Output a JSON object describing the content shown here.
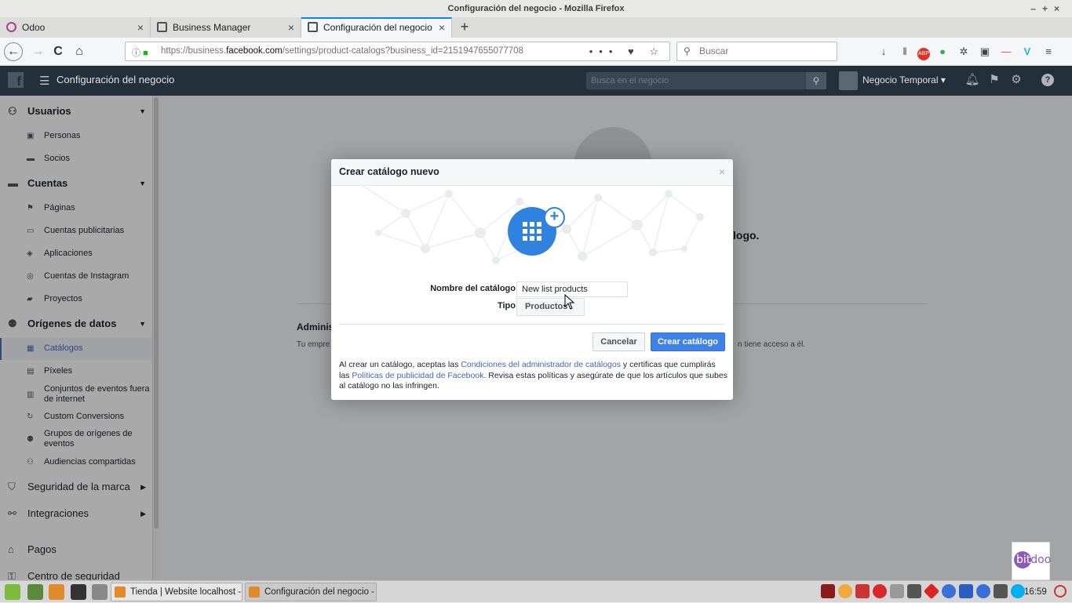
{
  "window": {
    "title": "Configuración del negocio - Mozilla Firefox",
    "controls": "–+×"
  },
  "tabs": [
    {
      "label": "Odoo",
      "close": "×"
    },
    {
      "label": "Business Manager",
      "close": "×"
    },
    {
      "label": "Configuración del negocio",
      "close": "×"
    }
  ],
  "new_tab": "+",
  "nav": {
    "back": "←",
    "forward": "→",
    "reload": "C",
    "home": "⌂",
    "url_prefix": "https://business.",
    "url_domain": "facebook.com",
    "url_path": "/settings/product-catalogs?business_id=2151947655077708",
    "url_icons": "••• ♥ ☆",
    "search_placeholder": "Buscar",
    "toolbar_icons": [
      "↓",
      "‖",
      "ABP",
      "●",
      "✲",
      "▣",
      "—",
      "V",
      "≡"
    ]
  },
  "fb_header": {
    "logo": "f",
    "title": "Configuración del negocio",
    "search_placeholder": "Busca en el negocio",
    "business_name": "Negocio Temporal ▾",
    "help": "?"
  },
  "sidebar": {
    "sections": [
      {
        "label": "Usuarios",
        "arrow": "▼"
      },
      {
        "label": "Cuentas",
        "arrow": "▼"
      },
      {
        "label": "Orígenes de datos",
        "arrow": "▼"
      },
      {
        "label": "Seguridad de la marca",
        "arrow": "▶"
      },
      {
        "label": "Integraciones",
        "arrow": "▶"
      },
      {
        "label": "Pagos"
      },
      {
        "label": "Centro de seguridad"
      }
    ],
    "items": {
      "personas": "Personas",
      "socios": "Socios",
      "paginas": "Páginas",
      "cuentas_publicitarias": "Cuentas publicitarias",
      "aplicaciones": "Aplicaciones",
      "cuentas_instagram": "Cuentas de Instagram",
      "proyectos": "Proyectos",
      "catalogos": "Catálogos",
      "pixeles": "Píxeles",
      "conjuntos_eventos": "Conjuntos de eventos fuera de internet",
      "custom_conversions": "Custom Conversions",
      "grupos_origenes": "Grupos de orígenes de eventos",
      "audiencias": "Audiencias compartidas"
    }
  },
  "main_bg": {
    "heading_fragment": "logo.",
    "section_title_fragment": "Adminis",
    "desc_fragment_left": "Tu empre",
    "desc_fragment_right": "n tiene acceso a él."
  },
  "modal": {
    "title": "Crear catálogo nuevo",
    "close": "×",
    "name_label": "Nombre del catálogo",
    "name_value": "New list products",
    "type_label": "Tipo",
    "type_value": "Productos",
    "cancel": "Cancelar",
    "create": "Crear catálogo",
    "terms": {
      "t1": "Al crear un catálogo, aceptas las ",
      "link1": "Condiciones del administrador de catálogos",
      "t2": " y certificas que cumplirás las ",
      "link2": "Políticas de publicidad de Facebook",
      "t3": ". Revisa estas políticas y asegúrate de que los artículos que subes al catálogo no las infringen."
    }
  },
  "watermark": {
    "part1": "bit",
    "part2": "doo"
  },
  "taskbar": {
    "tasks": [
      {
        "label": "Tienda | Website localhost - ..."
      },
      {
        "label": "Configuración del negocio - ..."
      }
    ],
    "clock": "16:59"
  }
}
